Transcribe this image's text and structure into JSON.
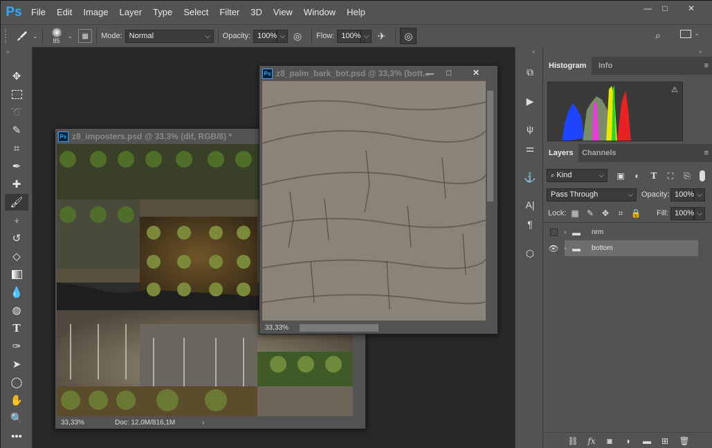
{
  "app": {
    "logo": "Ps",
    "menu": [
      "File",
      "Edit",
      "Image",
      "Layer",
      "Type",
      "Select",
      "Filter",
      "3D",
      "View",
      "Window",
      "Help"
    ],
    "window_controls": {
      "minimize": "—",
      "restore": "□",
      "close": "✕"
    }
  },
  "options": {
    "brush_size": "85",
    "mode_label": "Mode:",
    "mode_value": "Normal",
    "opacity_label": "Opacity:",
    "opacity_value": "100%",
    "flow_label": "Flow:",
    "flow_value": "100%"
  },
  "doc1": {
    "title": "z8_imposters.psd @ 33,3% (dif, RGB/8) *",
    "zoom": "33,33%",
    "status": "Doc: 12,0M/816,1M",
    "icon": "Ps"
  },
  "doc2": {
    "title": "z8_palm_bark_bot.psd @ 33,3% (bott...",
    "zoom": "33,33%",
    "icon": "Ps",
    "controls": {
      "minimize": "—",
      "restore": "□",
      "close": "✕"
    }
  },
  "histogram": {
    "tabs": [
      "Histogram",
      "Info"
    ],
    "warning": "⚠"
  },
  "layers": {
    "tabs": [
      "Layers",
      "Channels"
    ],
    "filter_kind": "Kind",
    "blend_mode": "Pass Through",
    "opacity_label": "Opacity:",
    "opacity_value": "100%",
    "lock_label": "Lock:",
    "fill_label": "Fill:",
    "fill_value": "100%",
    "items": [
      {
        "name": "nrm",
        "visible": false
      },
      {
        "name": "bottom",
        "visible": true
      }
    ]
  },
  "icons": {
    "search": "search-icon",
    "workspace": "workspace-icon",
    "brush": "brush-icon"
  },
  "colors": {
    "accent": "#31a8ff",
    "panel": "#535353",
    "canvas": "#282828"
  }
}
